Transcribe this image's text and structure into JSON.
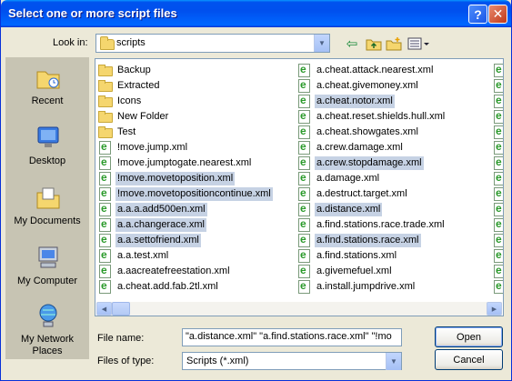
{
  "window": {
    "title": "Select one or more script files"
  },
  "lookin": {
    "label": "Look in:",
    "value": "scripts"
  },
  "places": [
    {
      "label": "Recent",
      "icon": "recent-icon"
    },
    {
      "label": "Desktop",
      "icon": "desktop-icon"
    },
    {
      "label": "My Documents",
      "icon": "my-documents-icon"
    },
    {
      "label": "My Computer",
      "icon": "my-computer-icon"
    },
    {
      "label": "My Network Places",
      "icon": "network-places-icon"
    }
  ],
  "files": {
    "col1": [
      {
        "name": "Backup",
        "kind": "folder",
        "selected": false
      },
      {
        "name": "Extracted",
        "kind": "folder",
        "selected": false
      },
      {
        "name": "Icons",
        "kind": "folder",
        "selected": false
      },
      {
        "name": "New Folder",
        "kind": "folder",
        "selected": false
      },
      {
        "name": "Test",
        "kind": "folder",
        "selected": false
      },
      {
        "name": "!move.jump.xml",
        "kind": "xml",
        "selected": false
      },
      {
        "name": "!move.jumptogate.nearest.xml",
        "kind": "xml",
        "selected": false
      },
      {
        "name": "!move.movetoposition.xml",
        "kind": "xml",
        "selected": true
      },
      {
        "name": "!move.movetopositioncontinue.xml",
        "kind": "xml",
        "selected": true
      },
      {
        "name": "a.a.a.add500en.xml",
        "kind": "xml",
        "selected": true
      },
      {
        "name": "a.a.changerace.xml",
        "kind": "xml",
        "selected": true
      },
      {
        "name": "a.a.settofriend.xml",
        "kind": "xml",
        "selected": true
      },
      {
        "name": "a.a.test.xml",
        "kind": "xml",
        "selected": false
      },
      {
        "name": "a.aacreatefreestation.xml",
        "kind": "xml",
        "selected": false
      },
      {
        "name": "a.cheat.add.fab.2tl.xml",
        "kind": "xml",
        "selected": false
      }
    ],
    "col2": [
      {
        "name": "a.cheat.attack.nearest.xml",
        "kind": "xml",
        "selected": false
      },
      {
        "name": "a.cheat.givemoney.xml",
        "kind": "xml",
        "selected": false
      },
      {
        "name": "a.cheat.notor.xml",
        "kind": "xml",
        "selected": true
      },
      {
        "name": "a.cheat.reset.shields.hull.xml",
        "kind": "xml",
        "selected": false
      },
      {
        "name": "a.cheat.showgates.xml",
        "kind": "xml",
        "selected": false
      },
      {
        "name": "a.crew.damage.xml",
        "kind": "xml",
        "selected": false
      },
      {
        "name": "a.crew.stopdamage.xml",
        "kind": "xml",
        "selected": true
      },
      {
        "name": "a.damage.xml",
        "kind": "xml",
        "selected": false
      },
      {
        "name": "a.destruct.target.xml",
        "kind": "xml",
        "selected": false
      },
      {
        "name": "a.distance.xml",
        "kind": "xml",
        "selected": true
      },
      {
        "name": "a.find.stations.race.trade.xml",
        "kind": "xml",
        "selected": false
      },
      {
        "name": "a.find.stations.race.xml",
        "kind": "xml",
        "selected": true
      },
      {
        "name": "a.find.stations.xml",
        "kind": "xml",
        "selected": false
      },
      {
        "name": "a.givemefuel.xml",
        "kind": "xml",
        "selected": false
      },
      {
        "name": "a.install.jumpdrive.xml",
        "kind": "xml",
        "selected": false
      }
    ]
  },
  "filename": {
    "label": "File name:",
    "value": "\"a.distance.xml\" \"a.find.stations.race.xml\" \"!mo"
  },
  "filetype": {
    "label": "Files of type:",
    "value": "Scripts (*.xml)"
  },
  "buttons": {
    "open": "Open",
    "cancel": "Cancel",
    "help": "?",
    "close": "✕"
  },
  "colors": {
    "selection": "#c6d2e4",
    "titlebar": "#0053ee"
  }
}
